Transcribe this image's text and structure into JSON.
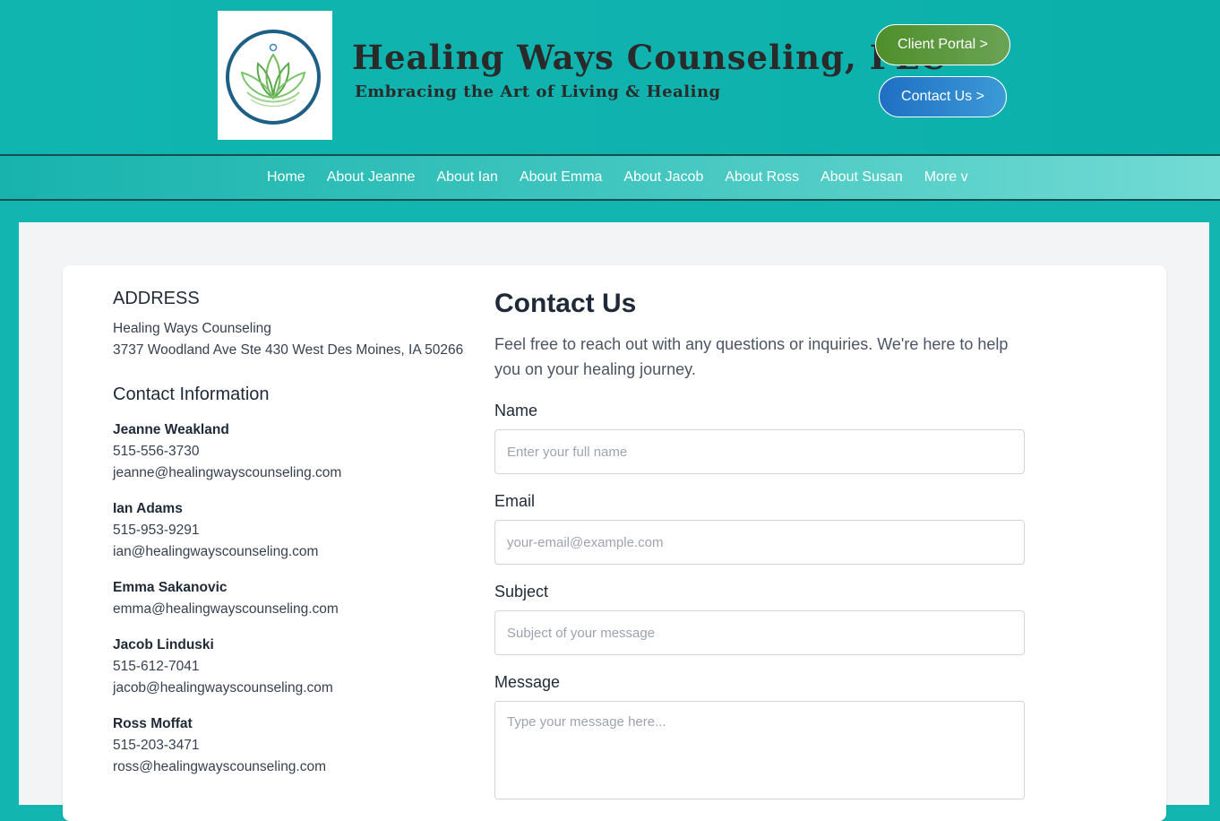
{
  "header": {
    "title": "Healing Ways Counseling, PLC",
    "tagline": "Embracing the Art of Living & Healing",
    "client_portal_label": "Client Portal >",
    "contact_us_label": "Contact Us >"
  },
  "nav": {
    "items": [
      "Home",
      "About Jeanne",
      "About Ian",
      "About Emma",
      "About Jacob",
      "About Ross",
      "About Susan",
      "More v"
    ]
  },
  "address": {
    "heading": "ADDRESS",
    "name": "Healing Ways Counseling",
    "street": "3737 Woodland Ave Ste 430 West Des Moines, IA 50266"
  },
  "contact_info": {
    "heading": "Contact Information",
    "people": [
      {
        "name": "Jeanne Weakland",
        "phone": "515-556-3730",
        "email": "jeanne@healingwayscounseling.com"
      },
      {
        "name": "Ian Adams",
        "phone": "515-953-9291",
        "email": "ian@healingwayscounseling.com"
      },
      {
        "name": "Emma Sakanovic",
        "email": "emma@healingwayscounseling.com"
      },
      {
        "name": "Jacob Linduski",
        "phone": "515-612-7041",
        "email": "jacob@healingwayscounseling.com"
      },
      {
        "name": "Ross Moffat",
        "phone": "515-203-3471",
        "email": "ross@healingwayscounseling.com"
      }
    ]
  },
  "form": {
    "heading": "Contact Us",
    "intro": "Feel free to reach out with any questions or inquiries. We're here to help you on your healing journey.",
    "name_label": "Name",
    "name_placeholder": "Enter your full name",
    "email_label": "Email",
    "email_placeholder": "your-email@example.com",
    "subject_label": "Subject",
    "subject_placeholder": "Subject of your message",
    "message_label": "Message",
    "message_placeholder": "Type your message here..."
  },
  "colors": {
    "page_bg": "#12b5b0",
    "portal_button": "#5a9a3a",
    "contact_button": "#2a80cc",
    "nav_border": "#174f4f",
    "content_bg": "#f3f4f6"
  }
}
